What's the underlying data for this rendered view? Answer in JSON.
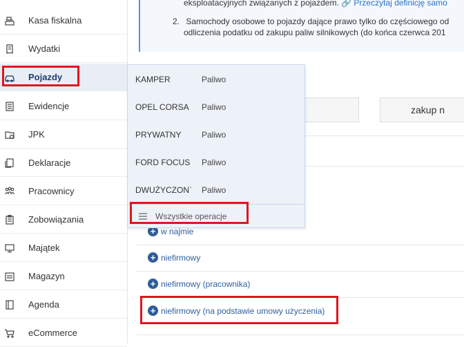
{
  "sidebar": {
    "items": [
      {
        "label": "Kasa fiskalna",
        "icon": "cash-register-icon"
      },
      {
        "label": "Wydatki",
        "icon": "receipt-icon"
      },
      {
        "label": "Pojazdy",
        "icon": "car-icon"
      },
      {
        "label": "Ewidencje",
        "icon": "ledger-icon"
      },
      {
        "label": "JPK",
        "icon": "jpk-file-icon"
      },
      {
        "label": "Deklaracje",
        "icon": "declaration-icon"
      },
      {
        "label": "Pracownicy",
        "icon": "people-icon"
      },
      {
        "label": "Zobowiązania",
        "icon": "clipboard-icon"
      },
      {
        "label": "Majątek",
        "icon": "monitor-icon"
      },
      {
        "label": "Magazyn",
        "icon": "warehouse-icon"
      },
      {
        "label": "Agenda",
        "icon": "agenda-icon"
      },
      {
        "label": "eCommerce",
        "icon": "cart-icon"
      }
    ]
  },
  "info": {
    "line1_text": "eksploatacyjnych związanych z pojazdem.",
    "line1_link": "Przeczytaj definicję samo",
    "line2_num": "2.",
    "line2_text": "Samochody osobowe to pojazdy dające prawo tylko do częściowego od",
    "line3_text": "odliczenia podatku od zakupu paliw silnikowych (do końca czerwca 201"
  },
  "buttons": {
    "zakup_label": "zakup n"
  },
  "options": [
    {
      "label": "w najmie"
    },
    {
      "label": "niefirmowy"
    },
    {
      "label": "niefirmowy (pracownika)"
    },
    {
      "label": "niefirmowy (na podstawie umowy użyczenia)"
    }
  ],
  "dropdown": {
    "rows": [
      {
        "vehicle": "KAMPER",
        "fuel": "Paliwo"
      },
      {
        "vehicle": "OPEL CORSA",
        "fuel": "Paliwo"
      },
      {
        "vehicle": "PRYWATNY",
        "fuel": "Paliwo"
      },
      {
        "vehicle": "FORD FOCUS",
        "fuel": "Paliwo"
      },
      {
        "vehicle": "DWUŻYCZON`",
        "fuel": "Paliwo"
      }
    ],
    "all_ops_label": "Wszystkie operacje"
  },
  "colors": {
    "highlight": "#e0141e",
    "accent": "#2e5d99",
    "active_bg": "#e9eef6"
  }
}
